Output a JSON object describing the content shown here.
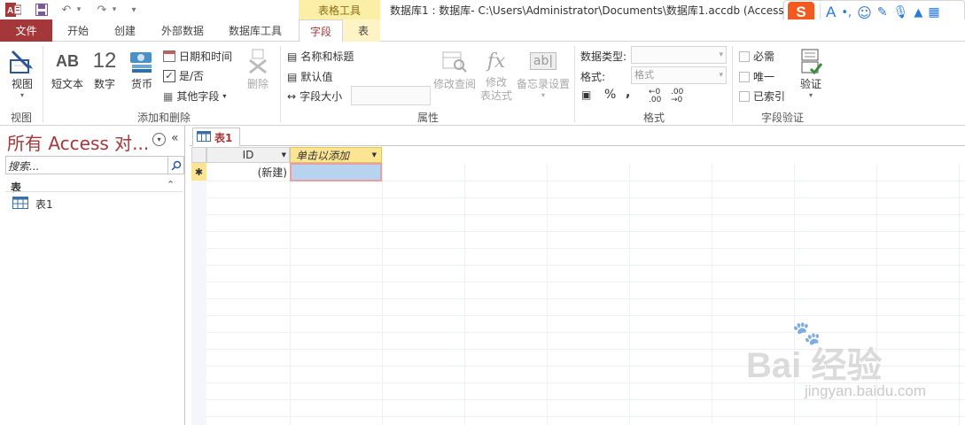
{
  "window": {
    "title": "数据库1 : 数据库- C:\\Users\\Administrator\\Documents\\数据库1.accdb (Access",
    "context_tool_label": "表格工具"
  },
  "quick_access": {
    "app_icon": "access-app-icon",
    "save": "save-icon",
    "undo": "undo-icon",
    "redo": "redo-icon",
    "customize": "▾"
  },
  "tabs": [
    {
      "label": "文件"
    },
    {
      "label": "开始"
    },
    {
      "label": "创建"
    },
    {
      "label": "外部数据"
    },
    {
      "label": "数据库工具"
    },
    {
      "label": "字段"
    },
    {
      "label": "表"
    }
  ],
  "ribbon": {
    "view_group": {
      "label": "视图",
      "button": "视图"
    },
    "add_delete_group": {
      "label": "添加和删除",
      "short_text": "短文本",
      "short_text_icon_text": "AB",
      "number": "数字",
      "number_icon_text": "12",
      "currency": "货币",
      "date_time": "日期和时间",
      "yes_no": "是/否",
      "more_fields": "其他字段",
      "delete": "删除"
    },
    "properties_group": {
      "label": "属性",
      "name_caption": "名称和标题",
      "default_value": "默认值",
      "field_size": "字段大小",
      "modify_lookups": "修改查阅",
      "modify_expression_1": "修改",
      "modify_expression_2": "表达式",
      "memo_settings": "备忘录设置",
      "fx_icon_text": "fx",
      "ab_icon_text": "ab|"
    },
    "formatting_group": {
      "label": "格式",
      "data_type_label": "数据类型:",
      "format_label": "格式:",
      "format_value": "格式",
      "percent": "%",
      "comma": ",",
      "inc_decimals": "←0 .00",
      "dec_decimals": ".00 →0"
    },
    "validation_group": {
      "label": "字段验证",
      "required": "必需",
      "unique": "唯一",
      "indexed": "已索引",
      "validation": "验证"
    }
  },
  "nav_pane": {
    "title": "所有 Access 对...",
    "search_placeholder": "搜索...",
    "section": "表",
    "items": [
      "表1"
    ]
  },
  "document": {
    "tab": "表1",
    "columns": [
      "ID",
      "单击以添加"
    ],
    "new_row_marker": "✱",
    "new_row_id": "(新建)"
  },
  "watermark": {
    "brand": "Bai 经验",
    "url": "jingyan.baidu.com"
  },
  "colors": {
    "accent": "#a4373a",
    "context": "#fbeea6",
    "selected_cell": "#b7d3ef"
  }
}
